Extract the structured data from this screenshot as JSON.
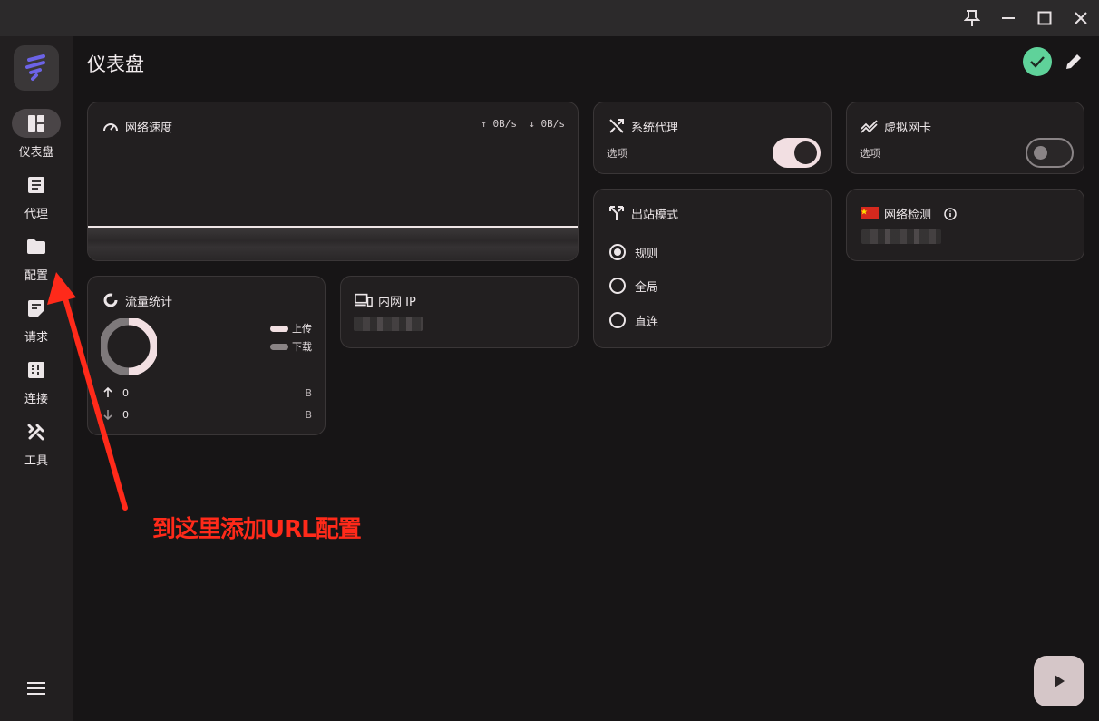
{
  "sidebar": {
    "items": [
      {
        "label": "仪表盘",
        "icon": "dashboard-icon"
      },
      {
        "label": "代理",
        "icon": "article-icon"
      },
      {
        "label": "配置",
        "icon": "folder-icon"
      },
      {
        "label": "请求",
        "icon": "rules-icon"
      },
      {
        "label": "连接",
        "icon": "connections-icon"
      },
      {
        "label": "工具",
        "icon": "tools-icon"
      }
    ]
  },
  "header": {
    "title": "仪表盘"
  },
  "cards": {
    "network_speed": {
      "title": "网络速度",
      "upload": "↑ 0B/s",
      "download": "↓ 0B/s"
    },
    "system_proxy": {
      "title": "系统代理",
      "sub": "选项",
      "enabled": true
    },
    "tun": {
      "title": "虚拟网卡",
      "sub": "选项",
      "enabled": false
    },
    "outbound_mode": {
      "title": "出站模式",
      "options": [
        "规则",
        "全局",
        "直连"
      ],
      "selected": "规则"
    },
    "network_check": {
      "title": "网络检测"
    },
    "traffic": {
      "title": "流量统计",
      "legend_upload": "上传",
      "legend_download": "下载",
      "upload_value": "0",
      "upload_unit": "B",
      "download_value": "0",
      "download_unit": "B"
    },
    "lan_ip": {
      "title": "内网 IP"
    }
  },
  "annotation": {
    "text": "到这里添加URL配置"
  },
  "colors": {
    "accent": "#f2dfe2",
    "status_ok": "#5fd29a",
    "annotation": "#ff2a1a",
    "upload_series": "#f2dfe2",
    "download_series": "#8a8486"
  }
}
